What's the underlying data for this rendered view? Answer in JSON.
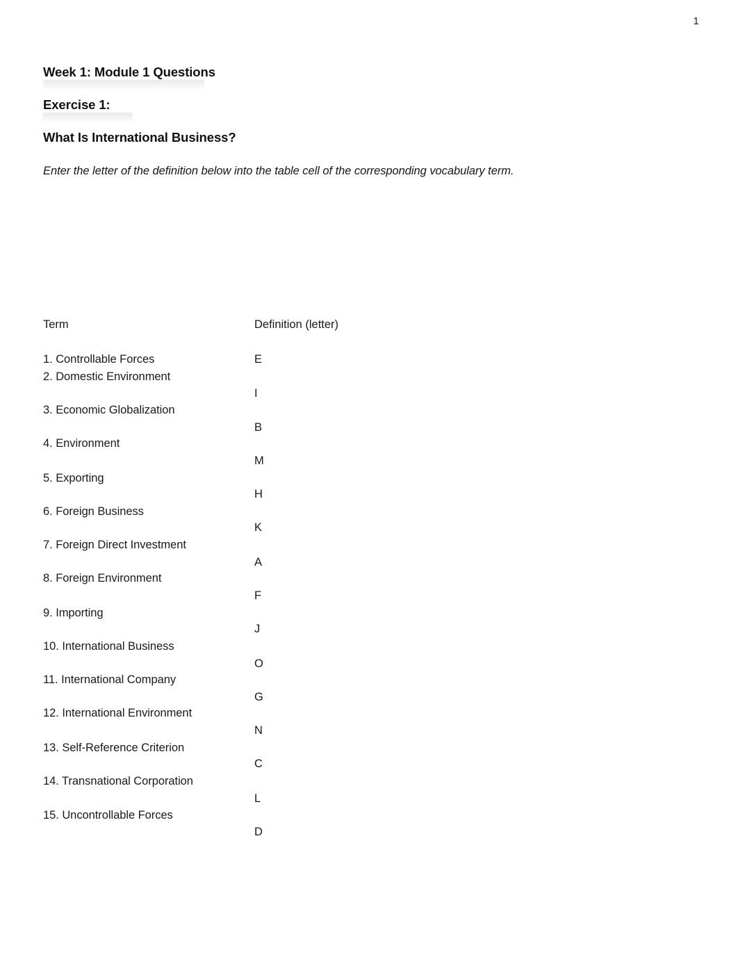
{
  "document": {
    "page_number": "1",
    "headings": {
      "week": "Week 1: Module 1 Questions",
      "exercise": "Exercise 1:",
      "topic": "What Is International Business?"
    },
    "instruction": "Enter the letter of the definition below into the table cell of the corresponding vocabulary term."
  },
  "table": {
    "columns": {
      "term": "Term",
      "definition": "Definition (letter)"
    },
    "rows": [
      {
        "term": "1. Controllable Forces",
        "letter": "E"
      },
      {
        "term": "2. Domestic Environment",
        "letter": "I"
      },
      {
        "term": "3. Economic Globalization",
        "letter": "B"
      },
      {
        "term": "4. Environment",
        "letter": "M"
      },
      {
        "term": "5. Exporting",
        "letter": "H"
      },
      {
        "term": "6. Foreign Business",
        "letter": "K"
      },
      {
        "term": "7. Foreign Direct Investment",
        "letter": "A"
      },
      {
        "term": "8. Foreign Environment",
        "letter": "F"
      },
      {
        "term": "9. Importing",
        "letter": "J"
      },
      {
        "term": "10. International Business",
        "letter": "O"
      },
      {
        "term": "11. International Company",
        "letter": "G"
      },
      {
        "term": "12. International Environment",
        "letter": "N"
      },
      {
        "term": "13. Self-Reference Criterion",
        "letter": "C"
      },
      {
        "term": "14. Transnational Corporation",
        "letter": "L"
      },
      {
        "term": "15. Uncontrollable Forces",
        "letter": "D"
      }
    ]
  },
  "layout": {
    "term_tops": [
      508,
      533,
      581,
      629,
      679,
      727,
      775,
      823,
      873,
      921,
      969,
      1017,
      1067,
      1115,
      1164
    ],
    "letter_tops": [
      508,
      557,
      606,
      654,
      702,
      750,
      800,
      848,
      896,
      946,
      994,
      1042,
      1090,
      1140,
      1188
    ]
  }
}
